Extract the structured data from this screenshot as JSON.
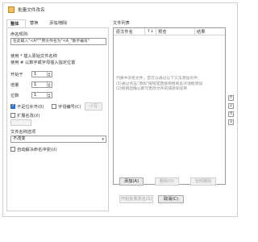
{
  "window": {
    "title": "批量文件改名"
  },
  "tabs": [
    "整体",
    "替换",
    "添加/删除"
  ],
  "naming": {
    "rule_label": "命名规则:",
    "rule_placeholder": "在此输入\"<A*\"\"原文件名为\"<A_\"数字编号\"",
    "help1": "使用 * 插入原始文件名称",
    "help2": "使用 # 以数字或字母插入指定位置",
    "start_label": "开始于",
    "start_value": "1",
    "increment_label": "增量",
    "increment_value": "1",
    "digits_label": "位数",
    "digits_value": "1",
    "pad_zero_label": "不足位补齐(0)",
    "pad_zero_checked": true,
    "letter_num_label": "字母编号(C)",
    "letter_num_checked": false,
    "letter_btn": "小写",
    "ext_label": "扩展名改(X)",
    "ext_checked": false,
    "case_label": "文件名称选项",
    "case_value": "不改变",
    "auto_resolve_label": "自动解决命名冲突(U)",
    "auto_resolve_checked": false
  },
  "file_list": {
    "label": "文件列表",
    "col_source": "原文件名",
    "col_sort": "↑↓",
    "col_preview": "预览",
    "col_result": "结果",
    "hint_lines": [
      "列表中没有文件，您可以通过以下方法添加文件：",
      "(1)通过点击\"添加\"按钮或直接拖拽到此对话框添加",
      "(2)拖拽后确认即可更改文件的排序和名称"
    ],
    "add_btn": "添加(A)",
    "remove_btn": "删除(D)",
    "clear_btn": "全部删除"
  },
  "footer": {
    "start_btn": "开始批量改名(S)",
    "cancel_btn": "取消(C)"
  },
  "side_icons": [
    "↑",
    "↓",
    "⇑",
    "⇓"
  ]
}
